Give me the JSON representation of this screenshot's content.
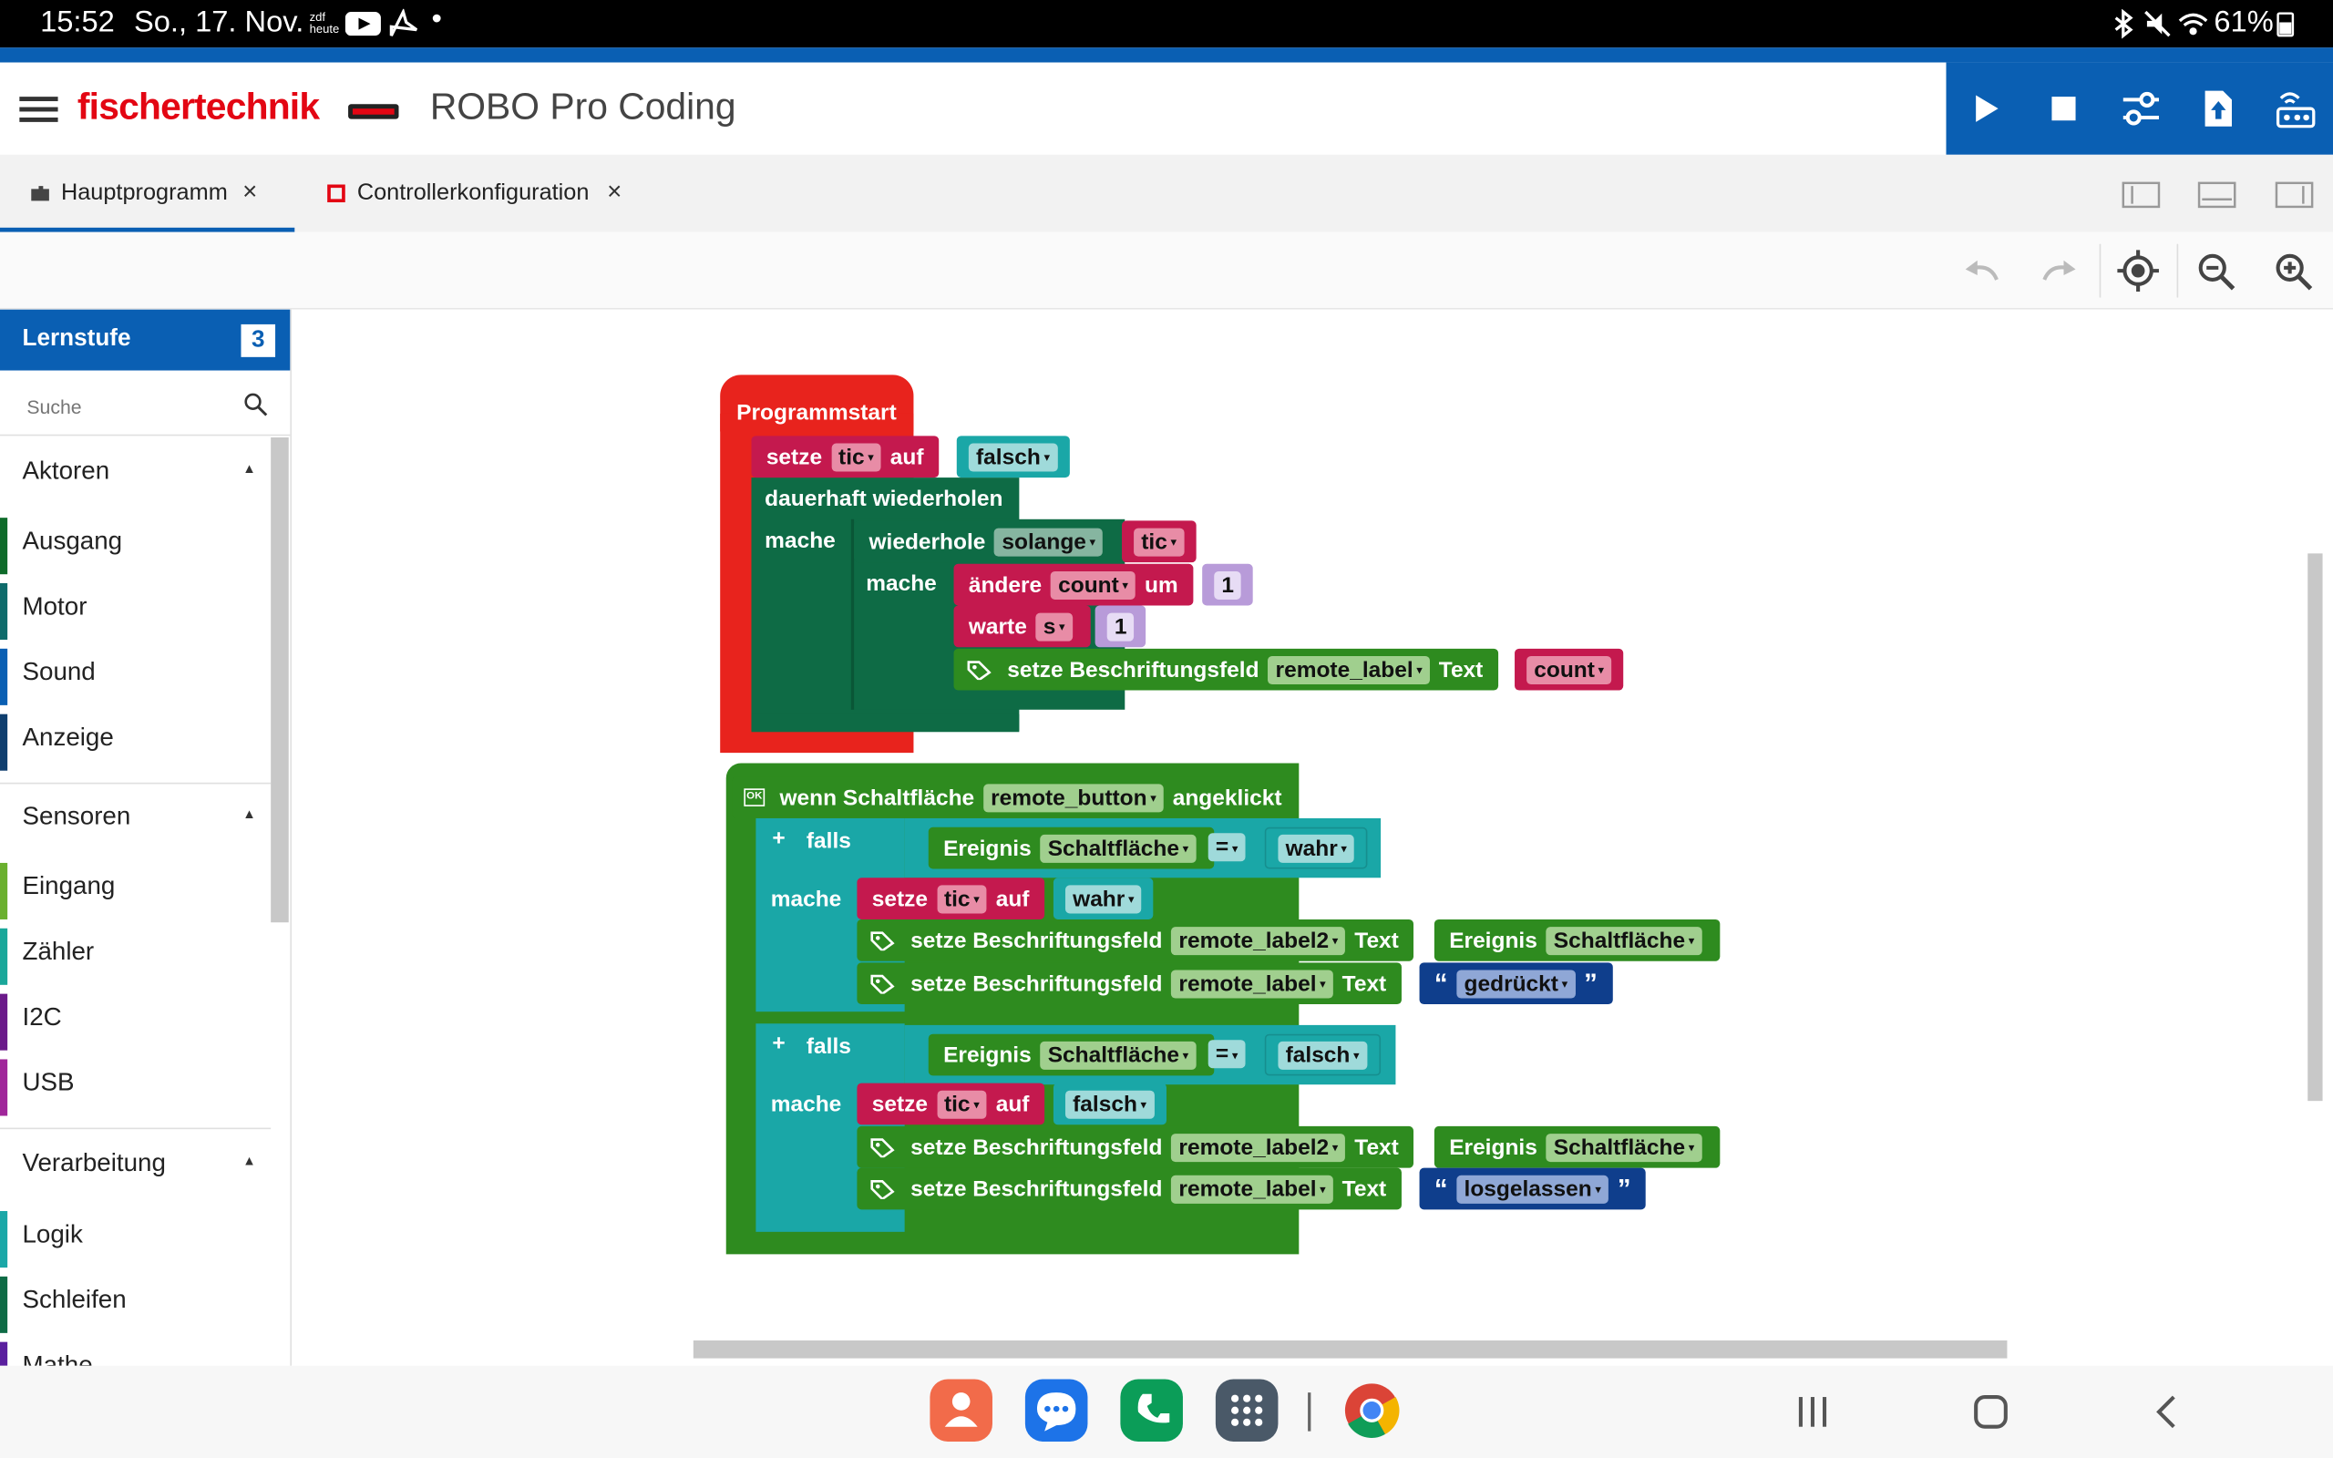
{
  "status": {
    "time": "15:52",
    "date": "So., 17. Nov.",
    "battery": "61%"
  },
  "app": {
    "brand": "fischertechnik",
    "title": "ROBO Pro Coding"
  },
  "tabs": [
    {
      "label": "Hauptprogramm",
      "close": "×"
    },
    {
      "label": "Controllerkonfiguration",
      "close": "×"
    }
  ],
  "sidebar": {
    "level_label": "Lernstufe",
    "level_value": "3",
    "search_placeholder": "Suche",
    "sections": [
      {
        "label": "Aktoren",
        "items": [
          "Ausgang",
          "Motor",
          "Sound",
          "Anzeige"
        ]
      },
      {
        "label": "Sensoren",
        "items": [
          "Eingang",
          "Zähler",
          "I2C",
          "USB"
        ]
      },
      {
        "label": "Verarbeitung",
        "items": [
          "Logik",
          "Schleifen",
          "Mathe"
        ]
      }
    ]
  },
  "blocks": {
    "programmstart": "Programmstart",
    "setze": "setze",
    "auf": "auf",
    "tic": "tic",
    "falsch": "falsch",
    "wahr": "wahr",
    "dauerhaft": "dauerhaft wiederholen",
    "mache": "mache",
    "wiederhole": "wiederhole",
    "solange": "solange",
    "aendere": "ändere",
    "count": "count",
    "um": "um",
    "one": "1",
    "warte": "warte",
    "s": "s",
    "setze_label": "setze Beschriftungsfeld",
    "remote_label": "remote_label",
    "remote_label2": "remote_label2",
    "text": "Text",
    "wenn": "wenn Schaltfläche",
    "remote_button": "remote_button",
    "angeklickt": "angeklickt",
    "falls": "falls",
    "ereignis": "Ereignis",
    "schaltflaeche": "Schaltfläche",
    "eq": "=",
    "gedrueckt": "gedrückt",
    "losgelassen": "losgelassen",
    "plus": "+",
    "ok": "OK"
  },
  "colors": {
    "blue": "#0a5fb3",
    "red": "#e8231d",
    "darkgreen": "#0e6b45",
    "crimson": "#c4194e",
    "teal": "#1aa7a7",
    "green": "#2e8b1f",
    "lavender": "#b89bd9",
    "navy": "#0f3e8c"
  }
}
